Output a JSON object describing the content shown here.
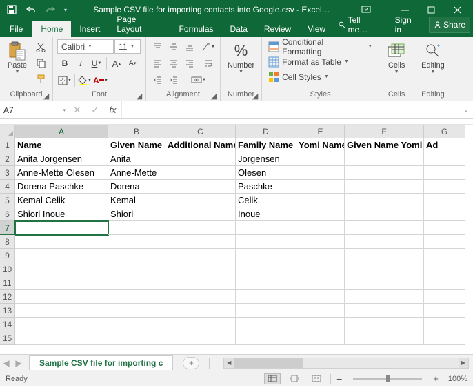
{
  "app": {
    "title": "Sample CSV file for importing contacts into Google.csv - Excel…"
  },
  "ribbon": {
    "tabs": {
      "file": "File",
      "home": "Home",
      "insert": "Insert",
      "page_layout": "Page Layout",
      "formulas": "Formulas",
      "data": "Data",
      "review": "Review",
      "view": "View"
    },
    "tell_me": "Tell me…",
    "sign_in": "Sign in",
    "share": "Share",
    "clipboard": {
      "label": "Clipboard",
      "paste": "Paste"
    },
    "font": {
      "label": "Font",
      "name": "Calibri",
      "size": "11"
    },
    "alignment": {
      "label": "Alignment"
    },
    "number": {
      "label": "Number",
      "btn": "Number"
    },
    "styles": {
      "label": "Styles",
      "cond_fmt": "Conditional Formatting",
      "fmt_table": "Format as Table",
      "cell_styles": "Cell Styles"
    },
    "cells": {
      "label": "Cells",
      "btn": "Cells"
    },
    "editing": {
      "label": "Editing",
      "btn": "Editing"
    }
  },
  "formula": {
    "cell_ref": "A7",
    "value": "",
    "fx": "fx"
  },
  "columns": [
    "A",
    "B",
    "C",
    "D",
    "E",
    "F",
    "G"
  ],
  "rows": [
    "1",
    "2",
    "3",
    "4",
    "5",
    "6",
    "7",
    "8",
    "9",
    "10",
    "11",
    "12",
    "13",
    "14",
    "15"
  ],
  "headers": {
    "A": "Name",
    "B": "Given Name",
    "C": "Additional Name",
    "D": "Family Name",
    "E": "Yomi Name",
    "F": "Given Name Yomi",
    "G": "Ad"
  },
  "data": [
    {
      "A": "Anita Jorgensen",
      "B": "Anita",
      "D": "Jorgensen"
    },
    {
      "A": "Anne-Mette Olesen",
      "B": "Anne-Mette",
      "D": "Olesen"
    },
    {
      "A": "Dorena Paschke",
      "B": "Dorena",
      "D": "Paschke"
    },
    {
      "A": "Kemal Celik",
      "B": "Kemal",
      "D": "Celik"
    },
    {
      "A": "Shiori Inoue",
      "B": "Shiori",
      "D": "Inoue"
    }
  ],
  "sheet": {
    "name": "Sample CSV file for importing c"
  },
  "status": {
    "ready": "Ready",
    "zoom": "100%"
  },
  "glyph": {
    "plus": "+",
    "minus": "−",
    "dash": "—",
    "caret_down": "▾",
    "tri_left": "◀",
    "tri_right": "▶",
    "chev_down": "⌄",
    "sep": ":"
  },
  "chart_data": {
    "type": "table",
    "columns": [
      "Name",
      "Given Name",
      "Additional Name",
      "Family Name",
      "Yomi Name",
      "Given Name Yomi"
    ],
    "rows": [
      [
        "Anita Jorgensen",
        "Anita",
        "",
        "Jorgensen",
        "",
        ""
      ],
      [
        "Anne-Mette Olesen",
        "Anne-Mette",
        "",
        "Olesen",
        "",
        ""
      ],
      [
        "Dorena Paschke",
        "Dorena",
        "",
        "Paschke",
        "",
        ""
      ],
      [
        "Kemal Celik",
        "Kemal",
        "",
        "Celik",
        "",
        ""
      ],
      [
        "Shiori Inoue",
        "Shiori",
        "",
        "Inoue",
        "",
        ""
      ]
    ]
  }
}
